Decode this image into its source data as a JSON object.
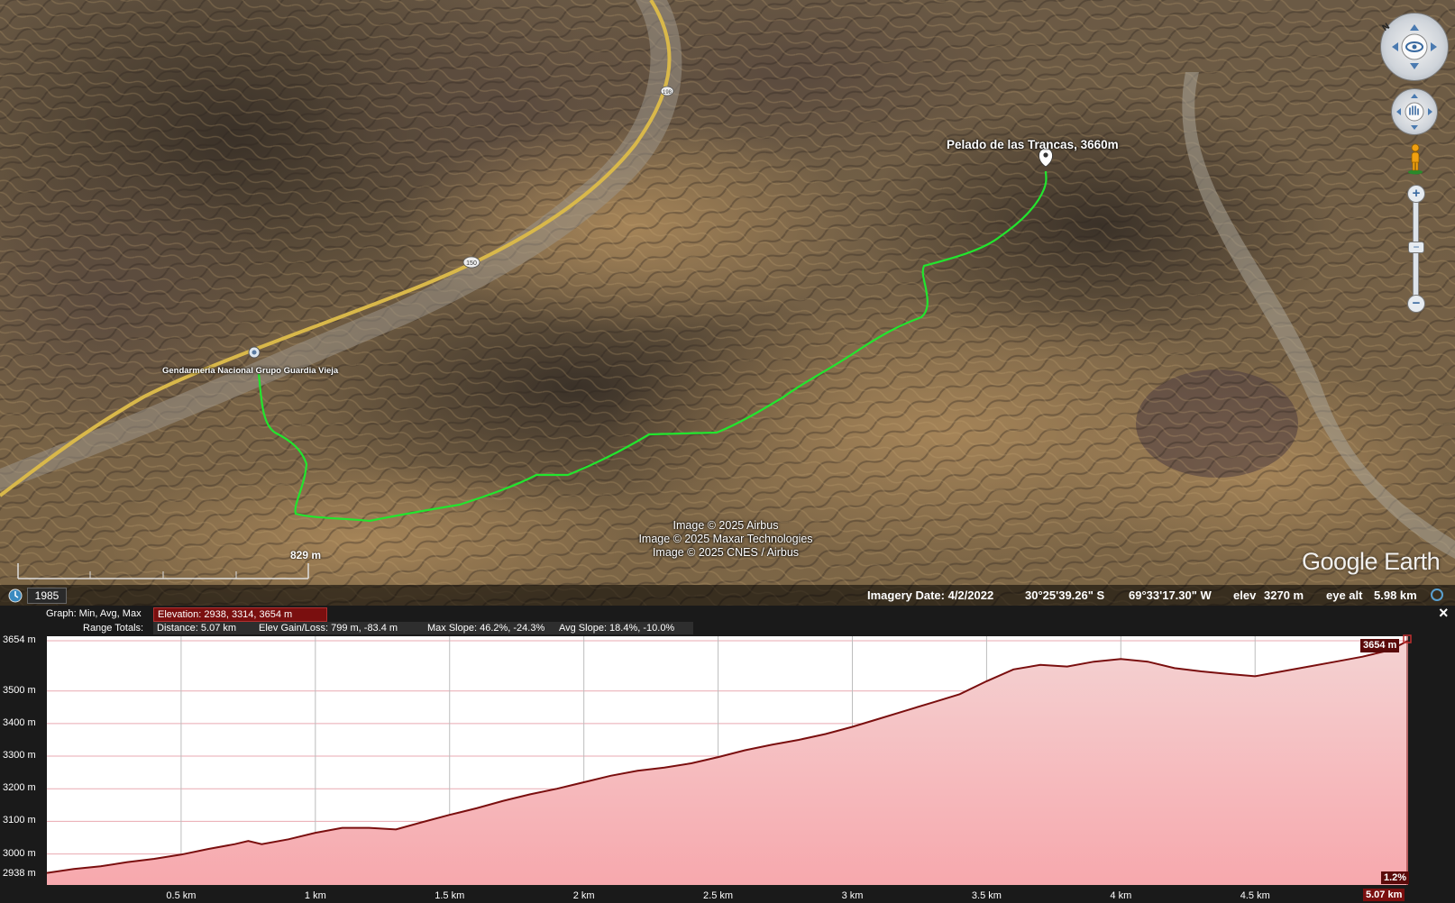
{
  "map": {
    "peak_label": "Pelado de las Trancas, 3660m",
    "station_label": "Gendarmería Nacional Grupo Guardia Vieja",
    "road_shields": [
      "198",
      "150"
    ],
    "attribution": [
      "Image © 2025 Airbus",
      "Image © 2025 Maxar Technologies",
      "Image © 2025 CNES / Airbus"
    ],
    "logo": "Google Earth",
    "scale_label": "829 m",
    "track_color": "#22e52e",
    "road_color": "#d9b84a"
  },
  "status": {
    "year": "1985",
    "imagery_date": "Imagery Date: 4/2/2022",
    "lat": "30°25'39.26\" S",
    "lon": "69°33'17.30\" W",
    "elev_label": "elev",
    "elev_value": "3270 m",
    "eye_alt_label": "eye alt",
    "eye_alt_value": "5.98 km"
  },
  "nav": {
    "look_icon": "eye-icon",
    "move_icon": "hand-icon",
    "pegman_icon": "pegman-icon",
    "north_label": "N",
    "zoom_in": "+",
    "zoom_out": "−",
    "zoom_minus_small": "−"
  },
  "graph": {
    "header_graph": "Graph: Min, Avg, Max",
    "elevation_stat": "Elevation: 2938, 3314, 3654 m",
    "range_totals": "Range Totals:",
    "distance": "Distance: 5.07 km",
    "elev_gain_loss": "Elev Gain/Loss: 799 m, -83.4 m",
    "max_slope": "Max Slope: 46.2%, -24.3%",
    "avg_slope": "Avg Slope: 18.4%, -10.0%",
    "close": "×",
    "end_elev_badge": "3654 m",
    "end_slope_badge": "1.2%",
    "end_dist_badge": "5.07 km",
    "accent": "#7a0f0f",
    "fill_top": "#f4d2d2",
    "fill_bottom": "#f7a8ad"
  },
  "chart_data": {
    "type": "area",
    "xlabel": "",
    "ylabel": "",
    "x_ticks": [
      "0.5 km",
      "1 km",
      "1.5 km",
      "2 km",
      "2.5 km",
      "3 km",
      "3.5 km",
      "4 km",
      "4.5 km"
    ],
    "y_ticks": [
      "3654 m",
      "3500 m",
      "3400 m",
      "3300 m",
      "3200 m",
      "3100 m",
      "3000 m",
      "2938 m"
    ],
    "y_tick_values": [
      3654,
      3500,
      3400,
      3300,
      3200,
      3100,
      3000,
      2938
    ],
    "x_tick_values": [
      0.5,
      1,
      1.5,
      2,
      2.5,
      3,
      3.5,
      4,
      4.5
    ],
    "xlim": [
      0,
      5.07
    ],
    "ylim": [
      2938,
      3654
    ],
    "series": [
      {
        "x": [
          0,
          0.1,
          0.2,
          0.3,
          0.4,
          0.5,
          0.6,
          0.7,
          0.75,
          0.8,
          0.9,
          1.0,
          1.1,
          1.2,
          1.3,
          1.4,
          1.5,
          1.6,
          1.7,
          1.8,
          1.9,
          2.0,
          2.1,
          2.2,
          2.3,
          2.4,
          2.5,
          2.6,
          2.7,
          2.8,
          2.9,
          3.0,
          3.1,
          3.2,
          3.3,
          3.4,
          3.5,
          3.6,
          3.7,
          3.8,
          3.9,
          4.0,
          4.1,
          4.2,
          4.3,
          4.4,
          4.5,
          4.6,
          4.7,
          4.8,
          4.9,
          5.0,
          5.07
        ],
        "y": [
          2942,
          2954,
          2962,
          2975,
          2985,
          2998,
          3015,
          3030,
          3040,
          3030,
          3045,
          3065,
          3080,
          3080,
          3075,
          3098,
          3120,
          3140,
          3163,
          3183,
          3200,
          3220,
          3240,
          3255,
          3265,
          3278,
          3297,
          3318,
          3335,
          3350,
          3368,
          3390,
          3415,
          3440,
          3465,
          3490,
          3530,
          3566,
          3580,
          3575,
          3590,
          3598,
          3590,
          3570,
          3560,
          3552,
          3545,
          3560,
          3575,
          3590,
          3605,
          3625,
          3654
        ]
      }
    ]
  }
}
